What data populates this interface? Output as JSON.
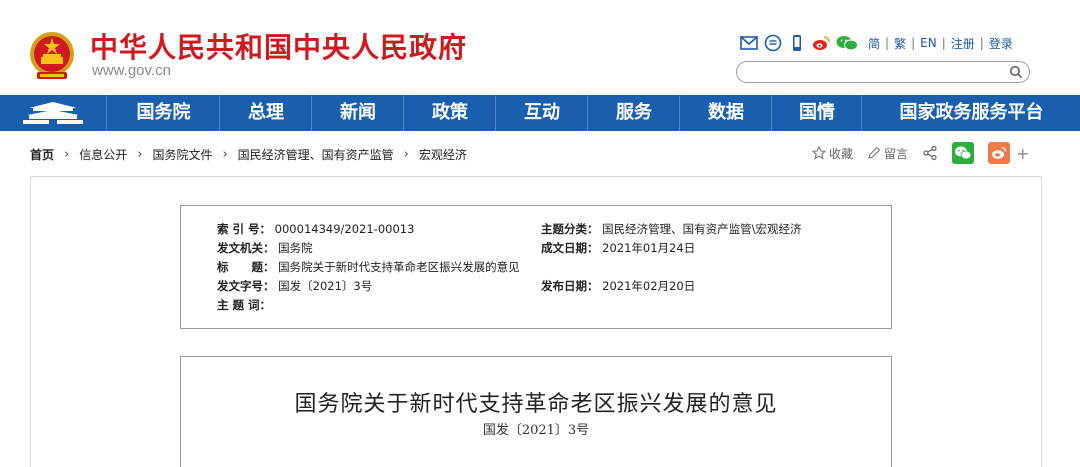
{
  "header": {
    "site_title": "中华人民共和国中央人民政府",
    "site_url": "www.gov.cn",
    "tool_icons": [
      "mail-icon",
      "message-icon",
      "mobile-icon",
      "weibo-icon",
      "wechat-icon"
    ],
    "lang_links": [
      "简",
      "繁",
      "EN",
      "注册",
      "登录"
    ],
    "search_placeholder": ""
  },
  "nav": {
    "items": [
      "国务院",
      "总理",
      "新闻",
      "政策",
      "互动",
      "服务",
      "数据",
      "国情",
      "国家政务服务平台"
    ]
  },
  "breadcrumb": {
    "items": [
      "首页",
      "信息公开",
      "国务院文件",
      "国民经济管理、国有资产监管",
      "宏观经济"
    ]
  },
  "share": {
    "collect": "收藏",
    "comment": "留言",
    "plus": "+"
  },
  "meta": {
    "index_label": "索 引 号：",
    "index_value": "000014349/2021-00013",
    "category_label": "主题分类：",
    "category_value": "国民经济管理、国有资产监管\\宏观经济",
    "issuer_label": "发文机关：",
    "issuer_value": "国务院",
    "date_made_label": "成文日期：",
    "date_made_value": "2021年01月24日",
    "title_label": "标　　题：",
    "title_value": "国务院关于新时代支持革命老区振兴发展的意见",
    "doc_no_label": "发文字号：",
    "doc_no_value": "国发〔2021〕3号",
    "pub_date_label": "发布日期：",
    "pub_date_value": "2021年02月20日",
    "keywords_label": "主 题 词："
  },
  "document": {
    "title": "国务院关于新时代支持革命老区振兴发展的意见",
    "number": "国发〔2021〕3号"
  },
  "colors": {
    "brand_red": "#d0191f",
    "nav_blue": "#1a5fad",
    "link_blue": "#1d5aa7",
    "wechat_green": "#2bae3c",
    "weibo_orange": "#f07a4c"
  }
}
